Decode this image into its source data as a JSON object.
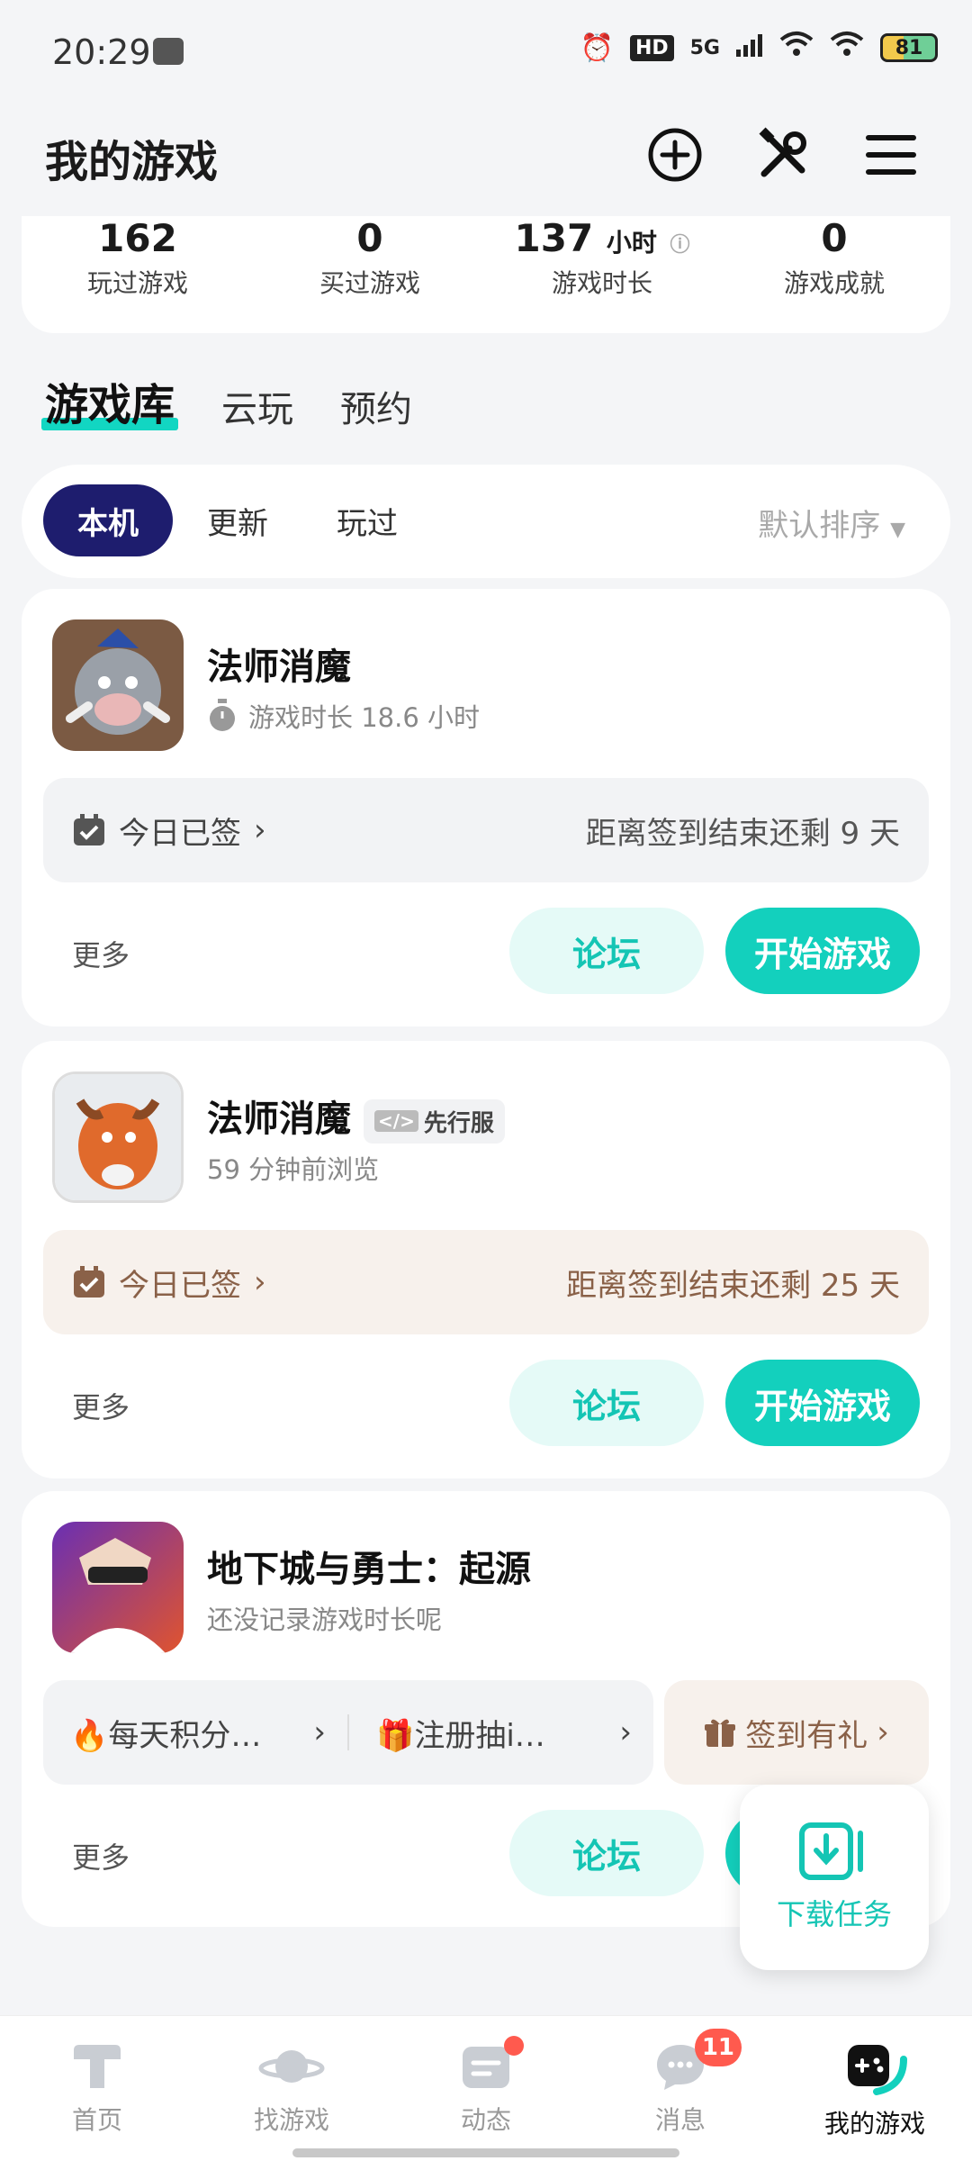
{
  "status_bar": {
    "time": "20:29",
    "battery": "81",
    "network": "5G"
  },
  "header": {
    "title": "我的游戏"
  },
  "stats": [
    {
      "value": "162",
      "unit": "",
      "label": "玩过游戏"
    },
    {
      "value": "0",
      "unit": "",
      "label": "买过游戏"
    },
    {
      "value": "137",
      "unit": "小时",
      "label": "游戏时长"
    },
    {
      "value": "0",
      "unit": "",
      "label": "游戏成就"
    }
  ],
  "tabs": [
    "游戏库",
    "云玩",
    "预约"
  ],
  "filters": {
    "chips": [
      "本机",
      "更新",
      "玩过"
    ],
    "sort": "默认排序"
  },
  "games": [
    {
      "name": "法师消魔",
      "subtitle": "游戏时长 18.6 小时",
      "sign_left": "今日已签",
      "sign_right": "距离签到结束还剩 9 天",
      "more": "更多",
      "forum": "论坛",
      "play": "开始游戏"
    },
    {
      "name": "法师消魔",
      "badge": "先行服",
      "subtitle": "59 分钟前浏览",
      "sign_left": "今日已签",
      "sign_right": "距离签到结束还剩 25 天",
      "more": "更多",
      "forum": "论坛",
      "play": "开始游戏"
    },
    {
      "name": "地下城与勇士：起源",
      "subtitle": "还没记录游戏时长呢",
      "promo1": "🔥每天积分…",
      "promo2": "🎁注册抽i…",
      "gift": "签到有礼",
      "more": "更多",
      "forum": "论坛"
    }
  ],
  "download_task": "下载任务",
  "bottom_nav": [
    {
      "label": "首页",
      "icon": "home-icon"
    },
    {
      "label": "找游戏",
      "icon": "planet-icon"
    },
    {
      "label": "动态",
      "icon": "feed-icon"
    },
    {
      "label": "消息",
      "icon": "message-icon",
      "badge": "11"
    },
    {
      "label": "我的游戏",
      "icon": "gamepad-icon"
    }
  ],
  "colors": {
    "accent": "#13d0bd",
    "chip_active": "#1e1d6e",
    "warm_text": "#8a6148"
  }
}
